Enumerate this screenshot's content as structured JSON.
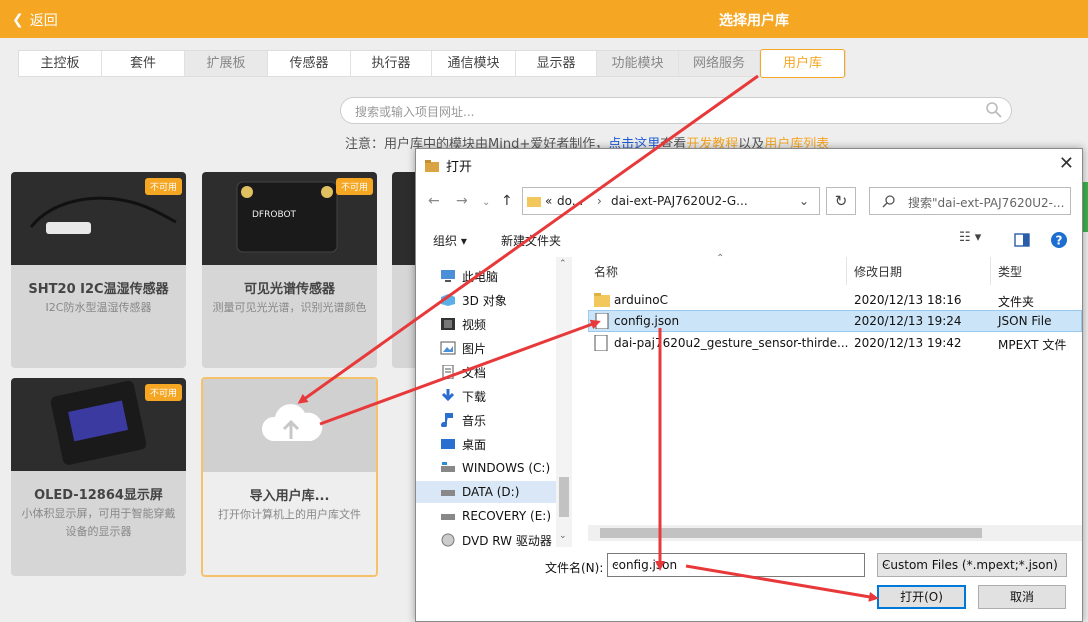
{
  "header": {
    "back_label": "返回",
    "title": "选择用户库"
  },
  "tabs": [
    {
      "label": "主控板",
      "state": "normal"
    },
    {
      "label": "套件",
      "state": "normal"
    },
    {
      "label": "扩展板",
      "state": "disabled"
    },
    {
      "label": "传感器",
      "state": "normal"
    },
    {
      "label": "执行器",
      "state": "normal"
    },
    {
      "label": "通信模块",
      "state": "normal"
    },
    {
      "label": "显示器",
      "state": "normal"
    },
    {
      "label": "功能模块",
      "state": "disabled"
    },
    {
      "label": "网络服务",
      "state": "disabled"
    },
    {
      "label": "用户库",
      "state": "active"
    }
  ],
  "search": {
    "placeholder": "搜索或输入项目网址..."
  },
  "note": {
    "prefix": "注意：用户库中的模块由Mind+爱好者制作，",
    "link": "点击这里",
    "mid": "查看",
    "dev": "开发教程",
    "and": "以及",
    "list": "用户库列表"
  },
  "cards": [
    {
      "name": "SHT20 I2C温湿传感器",
      "desc": "I2C防水型温湿传感器",
      "badge": "不可用"
    },
    {
      "name": "可见光谱传感器",
      "desc": "测量可见光光谱，识别光谱颜色",
      "badge": "不可用"
    },
    {
      "name": "OLED-12864显示屏",
      "desc": "小体积显示屏，可用于智能穿戴设备的显示器",
      "badge": "不可用"
    },
    {
      "name": "导入用户库...",
      "desc": "打开你计算机上的用户库文件",
      "badge": ""
    }
  ],
  "dialog": {
    "title": "打开",
    "address": {
      "prefix": "«",
      "seg1": "do...",
      "seg2": "dai-ext-PAJ7620U2-G..."
    },
    "search_placeholder": "搜索\"dai-ext-PAJ7620U2-...",
    "toolbar": {
      "organize": "组织 ▾",
      "new_folder": "新建文件夹"
    },
    "sidebar": [
      {
        "label": "此电脑",
        "icon": "computer-icon"
      },
      {
        "label": "3D 对象",
        "icon": "cube-icon"
      },
      {
        "label": "视频",
        "icon": "video-icon"
      },
      {
        "label": "图片",
        "icon": "picture-icon"
      },
      {
        "label": "文档",
        "icon": "document-icon"
      },
      {
        "label": "下载",
        "icon": "download-icon"
      },
      {
        "label": "音乐",
        "icon": "music-icon"
      },
      {
        "label": "桌面",
        "icon": "desktop-icon"
      },
      {
        "label": "WINDOWS (C:)",
        "icon": "drive-icon"
      },
      {
        "label": "DATA (D:)",
        "icon": "drive-icon"
      },
      {
        "label": "RECOVERY (E:)",
        "icon": "drive-icon"
      },
      {
        "label": "DVD RW 驱动器",
        "icon": "dvd-icon"
      }
    ],
    "columns": {
      "name": "名称",
      "modified": "修改日期",
      "type": "类型"
    },
    "files": [
      {
        "name": "arduinoC",
        "modified": "2020/12/13 18:16",
        "type": "文件夹",
        "icon": "folder-icon"
      },
      {
        "name": "config.json",
        "modified": "2020/12/13 19:24",
        "type": "JSON File",
        "icon": "file-icon"
      },
      {
        "name": "dai-paj7620u2_gesture_sensor-thirde...",
        "modified": "2020/12/13 19:42",
        "type": "MPEXT 文件",
        "icon": "file-icon"
      }
    ],
    "filename_label": "文件名(N):",
    "filename_value": "config.json",
    "filetype": "Custom Files (*.mpext;*.json)",
    "open_button": "打开(O)",
    "cancel_button": "取消"
  },
  "colors": {
    "accent": "#f5a623",
    "arrow": "#e8393a",
    "link": "#1e5bd6",
    "selection": "#cce4f7"
  }
}
